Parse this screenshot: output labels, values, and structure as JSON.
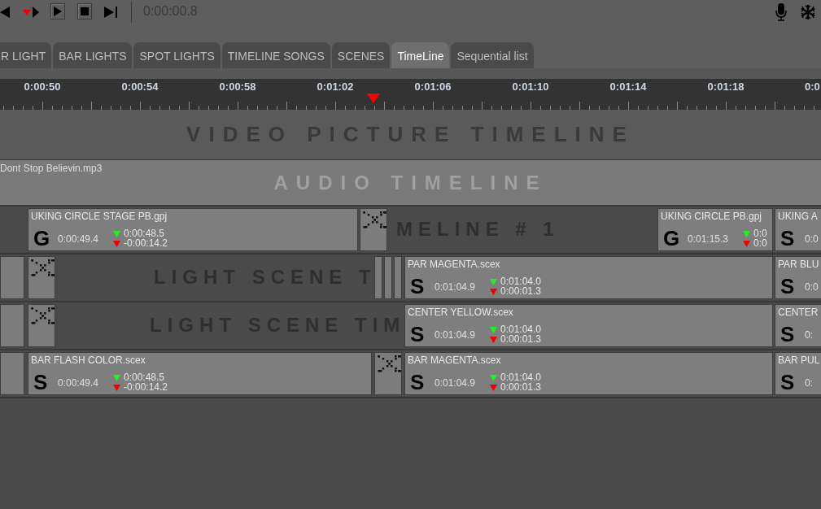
{
  "toolbar": {
    "time": "0:00:00.8"
  },
  "tabs": [
    {
      "label": "R LIGHT",
      "selected": false
    },
    {
      "label": "BAR LIGHTS",
      "selected": false
    },
    {
      "label": "SPOT LIGHTS",
      "selected": false
    },
    {
      "label": "TIMELINE SONGS",
      "selected": false
    },
    {
      "label": "SCENES",
      "selected": false
    },
    {
      "label": "TimeLine",
      "selected": true
    },
    {
      "label": "Sequential list",
      "selected": false
    }
  ],
  "ruler": {
    "labels": [
      "0:00:50",
      "0:00:54",
      "0:00:58",
      "0:01:02",
      "0:01:06",
      "0:01:10",
      "0:01:14",
      "0:01:18",
      "0:0"
    ]
  },
  "video_lane": {
    "title": "VIDEO PICTURE TIMELINE"
  },
  "audio_lane": {
    "title": "AUDIO TIMELINE",
    "file": "Dont Stop Believin.mp3"
  },
  "light_lanes": [
    {
      "title": "MELINE # 1",
      "items": [
        {
          "kind": "clip",
          "name": "UKING CIRCLE STAGE PB.gpj",
          "type": "G",
          "start": "0:00:49.4",
          "fade_in": "0:00:48.5",
          "fade_out": "-0:00:14.2"
        },
        {
          "kind": "marker"
        },
        {
          "kind": "clip",
          "name": "UKING CIRCLE PB.gpj",
          "type": "G",
          "start": "0:01:15.3",
          "fade_in": "0:0",
          "fade_out": "0:0"
        },
        {
          "kind": "clip",
          "name": "UKING A",
          "type": "S",
          "start": "0:0"
        }
      ]
    },
    {
      "title": "LIGHT SCENE T",
      "items": [
        {
          "kind": "blank"
        },
        {
          "kind": "marker"
        },
        {
          "kind": "bar"
        },
        {
          "kind": "bar"
        },
        {
          "kind": "bar"
        },
        {
          "kind": "clip",
          "name": "PAR MAGENTA.scex",
          "type": "S",
          "start": "0:01:04.9",
          "fade_in": "0:01:04.0",
          "fade_out": "0:00:01.3"
        },
        {
          "kind": "clip",
          "name": "PAR BLU",
          "type": "S",
          "start": "0:0"
        }
      ]
    },
    {
      "title": "LIGHT SCENE TIM",
      "items": [
        {
          "kind": "blank"
        },
        {
          "kind": "marker"
        },
        {
          "kind": "clip",
          "name": "CENTER YELLOW.scex",
          "type": "S",
          "start": "0:01:04.9",
          "fade_in": "0:01:04.0",
          "fade_out": "0:00:01.3"
        },
        {
          "kind": "clip",
          "name": "CENTER",
          "type": "S",
          "start": "0:"
        }
      ]
    },
    {
      "items": [
        {
          "kind": "blank"
        },
        {
          "kind": "clip",
          "name": "BAR FLASH COLOR.scex",
          "type": "S",
          "start": "0:00:49.4",
          "fade_in": "0:00:48.5",
          "fade_out": "-0:00:14.2"
        },
        {
          "kind": "marker"
        },
        {
          "kind": "clip",
          "name": "BAR MAGENTA.scex",
          "type": "S",
          "start": "0:01:04.9",
          "fade_in": "0:01:04.0",
          "fade_out": "0:00:01.3"
        },
        {
          "kind": "clip",
          "name": "BAR PUL",
          "type": "S",
          "start": "0:"
        }
      ]
    }
  ]
}
